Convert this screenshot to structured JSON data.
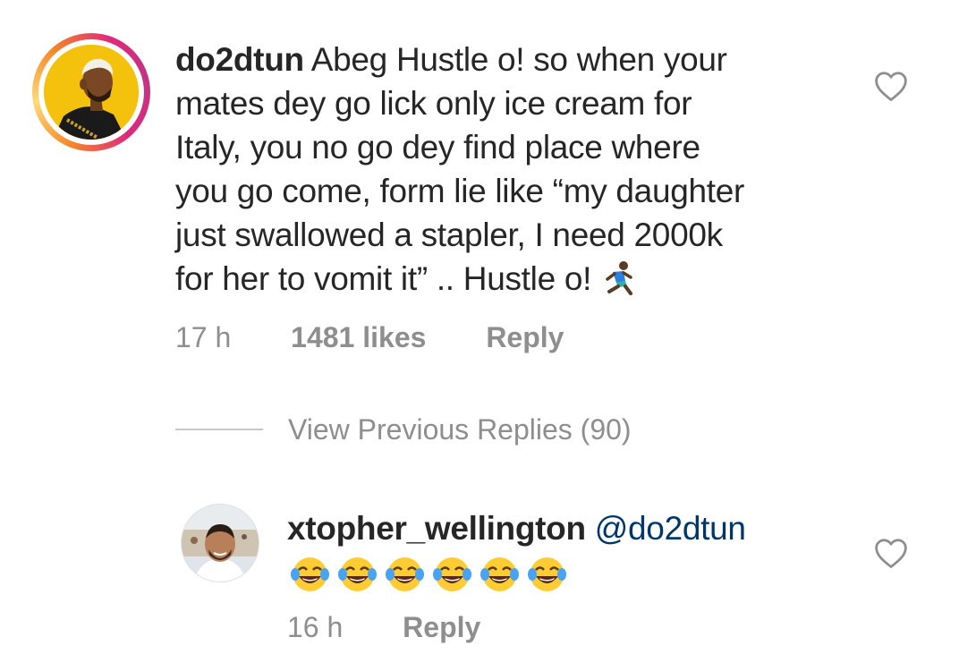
{
  "main_comment": {
    "username": "do2dtun",
    "text_lines": [
      " Abeg Hustle o! so when your",
      "mates dey go lick only ice cream for",
      "Italy, you no go dey find place where",
      "you go come, form lie like “my daughter",
      "just swallowed a stapler, I need 2000k",
      "for her to vomit it” .. Hustle o! "
    ],
    "trailing_emoji": "person-running-emoji",
    "time": "17 h",
    "likes": "1481 likes",
    "reply_label": "Reply",
    "avatar_icon": "cartoon-man-avatar",
    "story_ring_colors": [
      "#f58529",
      "#feda77",
      "#dd2a7b",
      "#c13584"
    ]
  },
  "view_previous_replies": "View Previous Replies (90)",
  "reply_comment": {
    "username": "xtopher_wellington",
    "mention": "@do2dtun",
    "emojis": [
      "tears-of-joy-emoji",
      "tears-of-joy-emoji",
      "tears-of-joy-emoji",
      "tears-of-joy-emoji",
      "tears-of-joy-emoji",
      "tears-of-joy-emoji"
    ],
    "time": "16 h",
    "reply_label": "Reply",
    "avatar_icon": "beach-selfie-avatar"
  },
  "icons": {
    "like": "heart-outline-icon"
  },
  "colors": {
    "text": "#262626",
    "secondary": "#8e8e8e",
    "mention": "#00376b"
  }
}
